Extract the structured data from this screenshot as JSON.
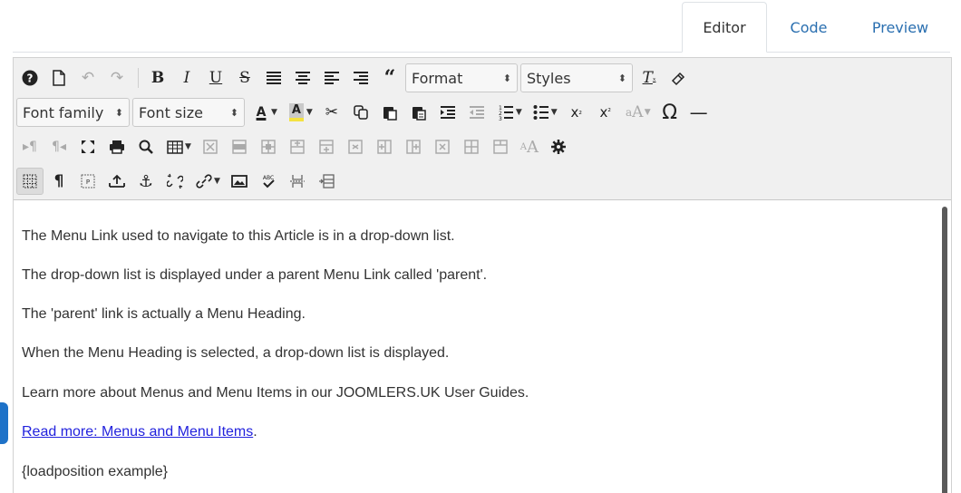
{
  "tabs": [
    {
      "label": "Editor"
    },
    {
      "label": "Code"
    },
    {
      "label": "Preview"
    }
  ],
  "toolbar": {
    "format_select": "Format",
    "styles_select": "Styles",
    "font_family_select": "Font family",
    "font_size_select": "Font size",
    "color_letter": "A"
  },
  "content": {
    "paragraphs": [
      "The Menu Link used to navigate to this Article is in a drop-down list.",
      "The drop-down list is displayed under a parent Menu Link called 'parent'.",
      "The 'parent' link is actually a Menu Heading.",
      "When the Menu Heading is selected, a drop-down list is displayed.",
      "Learn more about Menus and Menu Items in our JOOMLERS.UK User Guides."
    ],
    "link_text": "Read more: Menus and Menu Items",
    "link_suffix": ".",
    "loadposition": "{loadposition example}"
  },
  "colors": {
    "link": "#2222dd",
    "tab_link": "#2a6fb0",
    "highlight_bar": "#f4e241",
    "side_tab": "#1e72c8"
  }
}
